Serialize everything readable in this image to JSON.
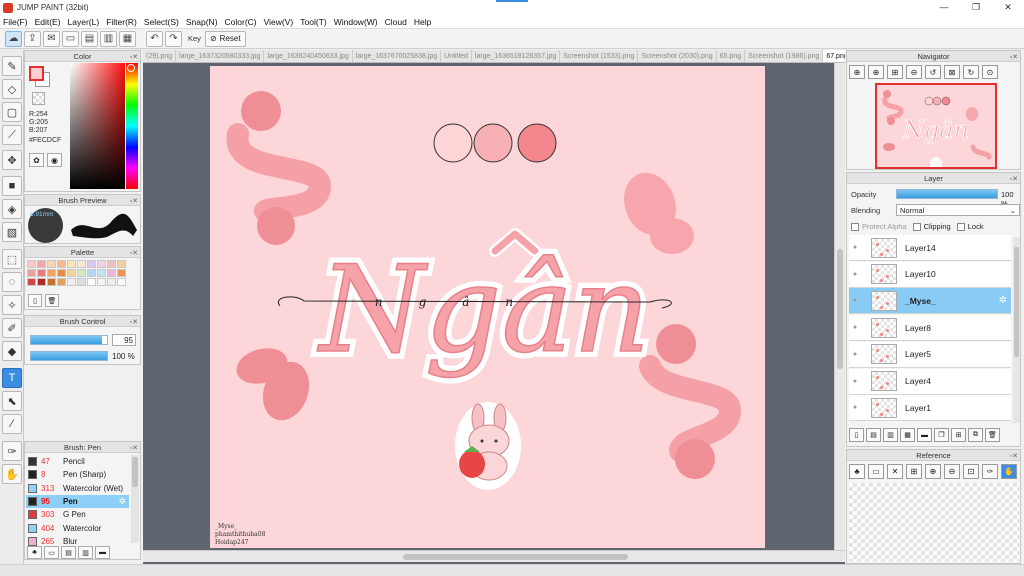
{
  "window": {
    "title": "JUMP PAINT (32bit)",
    "controls": [
      "—",
      "❐",
      "✕"
    ]
  },
  "menu": [
    "File(F)",
    "Edit(E)",
    "Layer(L)",
    "Filter(R)",
    "Select(S)",
    "Snap(N)",
    "Color(C)",
    "View(V)",
    "Tool(T)",
    "Window(W)",
    "Cloud",
    "Help"
  ],
  "toolbar": {
    "key_label": "Key",
    "reset_label": "Reset"
  },
  "color_panel": {
    "title": "Color",
    "r": "R:254",
    "g": "G:205",
    "b": "B:207",
    "hex": "#FECDCF",
    "current_color": "#FECDCF"
  },
  "brush_preview": {
    "title": "Brush Preview",
    "size": "6.91mm"
  },
  "palette": {
    "title": "Palette",
    "colors": [
      "#f8c9c9",
      "#f4a6a6",
      "#f9d4b5",
      "#f7b98e",
      "#fde3b8",
      "#fbe9d3",
      "#d9c7f4",
      "#f5d0e8",
      "#f0c0c0",
      "#f7cfa1",
      "#e8a0a0",
      "#e77b7b",
      "#f1a35f",
      "#e68a3f",
      "#f6d29a",
      "#d2e8c1",
      "#b5d8f5",
      "#c4e3f3",
      "#e9b7d7",
      "#e9955a",
      "#d04848",
      "#b02828",
      "#c97030",
      "#e0a060",
      "#f0f0f0",
      "#dddddd",
      "#ffffff",
      "#f5f5f5",
      "#eeeeee",
      "#fafafa"
    ]
  },
  "brush_control": {
    "title": "Brush Control",
    "size_value": "95",
    "size_fraction": 0.93,
    "opacity_value": "100 %",
    "opacity_fraction": 1.0
  },
  "brush_list": {
    "title": "Brush: Pen",
    "items": [
      {
        "num": "47",
        "name": "Pencil",
        "color": "#333333"
      },
      {
        "num": "8",
        "name": "Pen (Sharp)",
        "color": "#222222"
      },
      {
        "num": "313",
        "name": "Watercolor (Wet)",
        "color": "#8fd3f7"
      },
      {
        "num": "95",
        "name": "Pen",
        "color": "#222222"
      },
      {
        "num": "303",
        "name": "G Pen",
        "color": "#e33b3b"
      },
      {
        "num": "404",
        "name": "Watercolor",
        "color": "#8fd3f7"
      },
      {
        "num": "265",
        "name": "Blur",
        "color": "#f0b0d0"
      }
    ],
    "selected_index": 3
  },
  "tabs": [
    "(29).png",
    "large_1637320580333.jpg",
    "large_1638240450633.jpg",
    "large_1637670025838.jpg",
    "Untitled",
    "large_1636518128357.jpg",
    "Screenshot (1533).png",
    "Screenshot (2030).png",
    "65.png",
    "Screenshot (1986).png",
    "67.png"
  ],
  "active_tab": 10,
  "artwork": {
    "title_text": "Ngân",
    "hat": "^",
    "subtitle": "ngân",
    "swatches": [
      "#fdd5d6",
      "#f7b0b3",
      "#f4878d"
    ],
    "credit_lines": [
      "_Myse_",
      "phamthithuha08",
      "Hoidap247"
    ]
  },
  "navigator": {
    "title": "Navigator",
    "thumb_text": "Ngân"
  },
  "layer_panel": {
    "title": "Layer",
    "opacity_label": "Opacity",
    "opacity_value": "100 %",
    "blending_label": "Blending",
    "blending_value": "Normal",
    "protect_alpha": "Protect Alpha",
    "clipping": "Clipping",
    "lock": "Lock",
    "layers": [
      "Layer14",
      "Layer10",
      "_Myse_",
      "Layer8",
      "Layer5",
      "Layer4",
      "Layer1"
    ],
    "selected_index": 2
  },
  "reference": {
    "title": "Reference"
  }
}
